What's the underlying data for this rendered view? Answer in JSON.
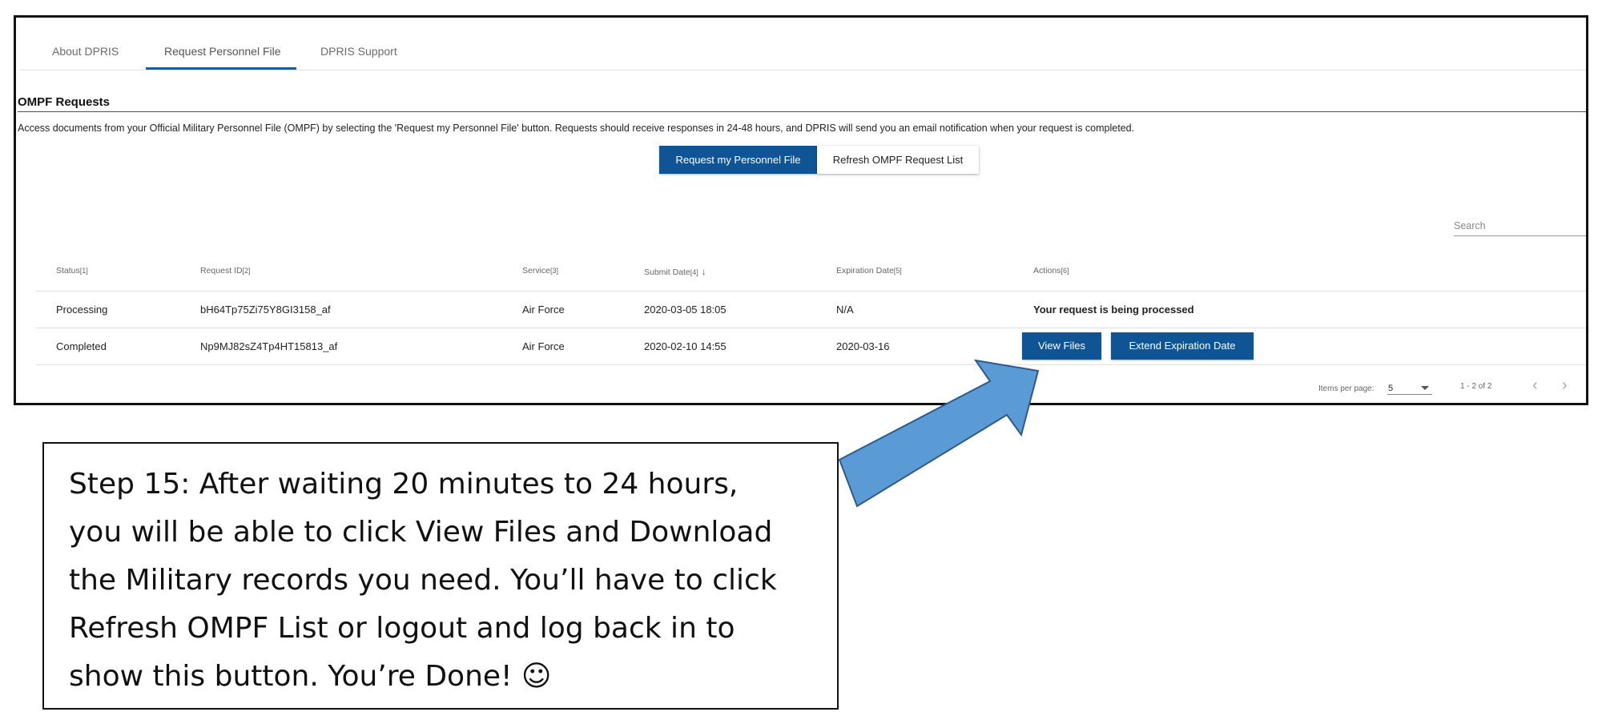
{
  "tabs": [
    "About DPRIS",
    "Request Personnel File",
    "DPRIS Support"
  ],
  "section": {
    "title": "OMPF Requests",
    "description": "Access documents from your Official Military Personnel File (OMPF) by selecting the 'Request my Personnel File' button. Requests should receive responses in 24-48 hours, and DPRIS will send you an email notification when your request is completed."
  },
  "buttons": {
    "request": "Request my Personnel File",
    "refresh": "Refresh OMPF Request List",
    "view_files": "View Files",
    "extend": "Extend Expiration Date"
  },
  "search": {
    "placeholder": "Search"
  },
  "table": {
    "headers": [
      {
        "label": "Status",
        "ref": "[1]"
      },
      {
        "label": "Request ID",
        "ref": "[2]"
      },
      {
        "label": "Service",
        "ref": "[3]"
      },
      {
        "label": "Submit Date",
        "ref": "[4]"
      },
      {
        "label": "Expiration Date",
        "ref": "[5]"
      },
      {
        "label": "Actions",
        "ref": "[6]"
      }
    ],
    "rows": [
      {
        "status": "Processing",
        "id": "bH64Tp75Zi75Y8GI3158_af",
        "service": "Air Force",
        "submit": "2020-03-05 18:05",
        "expiration": "N/A",
        "action_text": "Your request is being processed"
      },
      {
        "status": "Completed",
        "id": "Np9MJ82sZ4Tp4HT15813_af",
        "service": "Air Force",
        "submit": "2020-02-10 14:55",
        "expiration": "2020-03-16"
      }
    ]
  },
  "pager": {
    "label": "Items per page:",
    "value": "5",
    "range": "1 - 2 of 2",
    "prev": "‹",
    "next": "›"
  },
  "sort_icon": "↓",
  "callout": {
    "lines": [
      "Step 15:  After waiting 20 minutes to 24 hours,",
      "you will be able to click View Files and Download",
      "the Military records you need. You’ll have to click",
      "Refresh OMPF List or logout and log back in to",
      "show this button. You’re Done! ☺"
    ],
    "arrow_color": "#5b9bd5"
  }
}
